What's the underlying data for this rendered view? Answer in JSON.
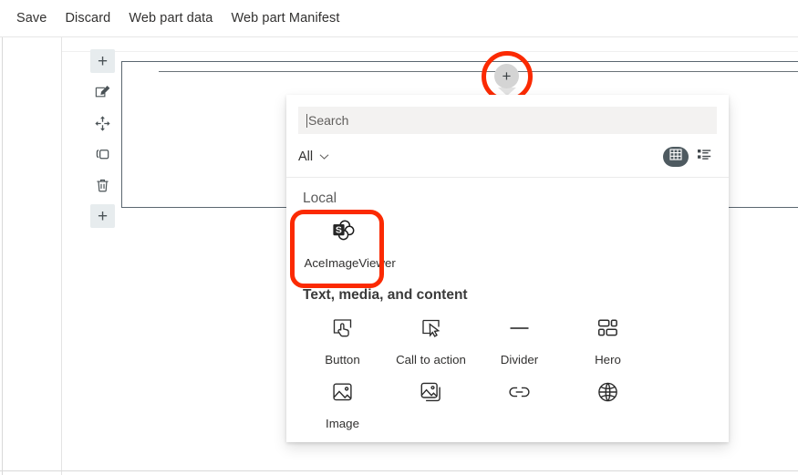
{
  "command_bar": {
    "items": [
      {
        "label": "Save",
        "name": "save-button"
      },
      {
        "label": "Discard",
        "name": "discard-button"
      },
      {
        "label": "Web part data",
        "name": "web-part-data-button"
      },
      {
        "label": "Web part Manifest",
        "name": "web-part-manifest-button"
      }
    ]
  },
  "canvas": {
    "toolbar": [
      {
        "icon": "plus-icon",
        "name": "add-section-above-button",
        "glyph": "+"
      },
      {
        "icon": "edit-pencil-icon",
        "name": "edit-web-part-button"
      },
      {
        "icon": "move-handle-icon",
        "name": "move-web-part-button"
      },
      {
        "icon": "duplicate-icon",
        "name": "duplicate-web-part-button"
      },
      {
        "icon": "trash-icon",
        "name": "delete-web-part-button"
      },
      {
        "icon": "plus-icon",
        "name": "add-section-below-button",
        "glyph": "+"
      }
    ],
    "add_web_part_button": {
      "glyph": "+",
      "name": "add-web-part-button",
      "highlight_color": "#fb2a02"
    }
  },
  "picker": {
    "search": {
      "placeholder": "Search",
      "value": ""
    },
    "filter": {
      "selected": "All",
      "options": [
        "All"
      ]
    },
    "view_toggle": {
      "grid_label": "grid-view",
      "list_label": "list-view",
      "active": "grid-view",
      "active_bg": "#4e5a60"
    },
    "sections": [
      {
        "title": "Local",
        "name": "section-local",
        "items": [
          {
            "label": "AceImageViewer",
            "icon": "sharepoint-webpart-icon",
            "name": "web-part-aceimageviewer",
            "highlighted": true
          }
        ]
      },
      {
        "title": "Text, media, and content",
        "name": "section-text-media-and-content",
        "items": [
          {
            "label": "Button",
            "icon": "button-tap-icon",
            "name": "web-part-button"
          },
          {
            "label": "Call to action",
            "icon": "cursor-box-icon",
            "name": "web-part-call-to-action"
          },
          {
            "label": "Divider",
            "icon": "divider-line-icon",
            "name": "web-part-divider"
          },
          {
            "label": "Hero",
            "icon": "hero-layout-icon",
            "name": "web-part-hero"
          },
          {
            "label": "Image",
            "icon": "image-icon",
            "name": "web-part-image"
          },
          {
            "label": "",
            "icon": "image-gallery-icon",
            "name": "web-part-image-gallery"
          },
          {
            "label": "",
            "icon": "link-icon",
            "name": "web-part-link"
          },
          {
            "label": "",
            "icon": "globe-embed-icon",
            "name": "web-part-embed"
          },
          {
            "label": "",
            "icon": "spacer-icon",
            "name": "web-part-spacer"
          },
          {
            "label": "",
            "icon": "send-arrow-icon",
            "name": "web-part-send"
          }
        ]
      }
    ]
  }
}
